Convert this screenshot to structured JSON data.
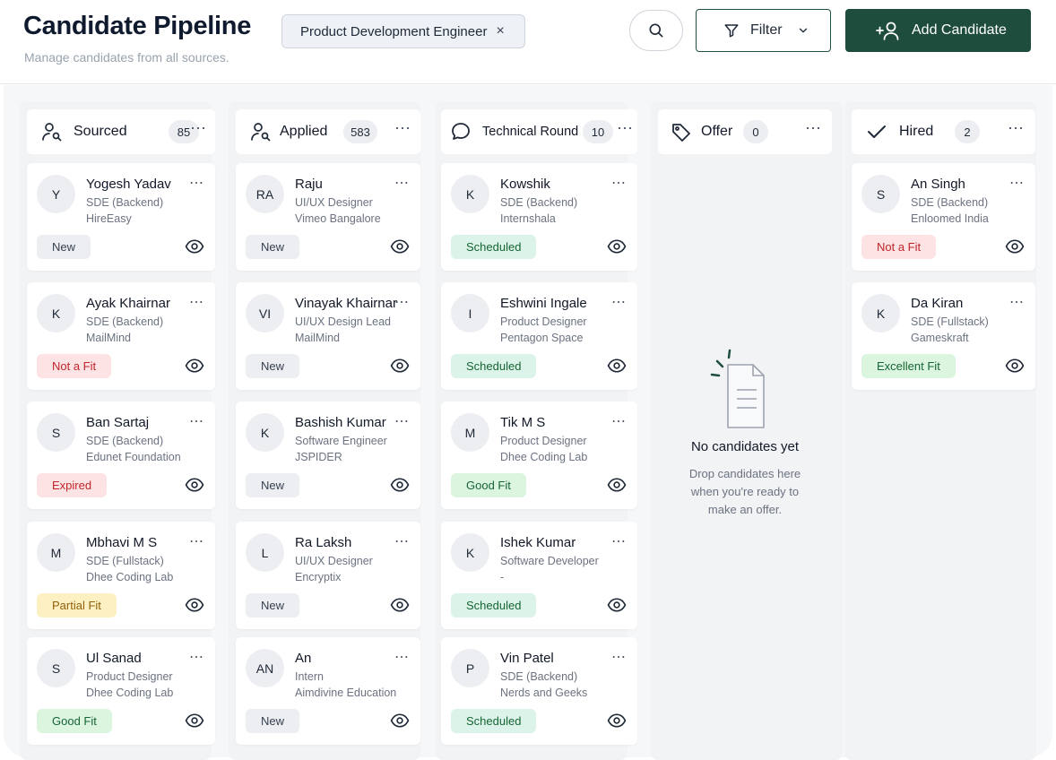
{
  "header": {
    "title": "Candidate Pipeline",
    "subtitle": "Manage candidates from all sources.",
    "job_chip": "Product Development Engineer",
    "job_chip_remove": "×",
    "filter_label": "Filter",
    "add_label": "Add Candidate"
  },
  "colors": {
    "accent": "#1e4d3e",
    "badge_new": "#eceef1",
    "badge_scheduled": "#dcf3e9",
    "badge_good": "#dcf5df",
    "badge_excellent": "#dcf5df",
    "badge_notfit": "#fde3e3",
    "badge_expired": "#fde3e3",
    "badge_partial": "#fdf1c4"
  },
  "columns": [
    {
      "title": "Sourced",
      "count": "85",
      "icon": "user-search-icon",
      "cards": [
        {
          "initials": "Y",
          "name": "Yogesh Yadav",
          "role": "SDE (Backend)",
          "org": "HireEasy",
          "status": "New",
          "kind": "new"
        },
        {
          "initials": "K",
          "name": "Ayak Khairnar",
          "role": "SDE (Backend)",
          "org": "MailMind",
          "status": "Not a Fit",
          "kind": "notfit"
        },
        {
          "initials": "S",
          "name": "Ban Sartaj",
          "role": "SDE (Backend)",
          "org": "Edunet Foundation",
          "status": "Expired",
          "kind": "expired"
        },
        {
          "initials": "M",
          "name": "Mbhavi M S",
          "role": "SDE (Fullstack)",
          "org": "Dhee Coding Lab",
          "status": "Partial Fit",
          "kind": "partial"
        },
        {
          "initials": "S",
          "name": "Ul Sanad",
          "role": "Product Designer",
          "org": "Dhee Coding Lab",
          "status": "Good Fit",
          "kind": "good"
        }
      ]
    },
    {
      "title": "Applied",
      "count": "583",
      "icon": "user-search-icon",
      "cards": [
        {
          "initials": "RA",
          "name": "Raju",
          "role": "UI/UX Designer",
          "org": "Vimeo Bangalore",
          "status": "New",
          "kind": "new"
        },
        {
          "initials": "VI",
          "name": "Vinayak Khairnar",
          "role": "UI/UX Design Lead",
          "org": "MailMind",
          "status": "New",
          "kind": "new"
        },
        {
          "initials": "K",
          "name": "Bashish Kumar",
          "role": "Software Engineer",
          "org": "JSPIDER",
          "status": "New",
          "kind": "new"
        },
        {
          "initials": "L",
          "name": "Ra Laksh",
          "role": "UI/UX Designer",
          "org": "Encryptix",
          "status": "New",
          "kind": "new"
        },
        {
          "initials": "AN",
          "name": "An",
          "role": "Intern",
          "org": "Aimdivine Education",
          "status": "New",
          "kind": "new"
        }
      ]
    },
    {
      "title": "Technical Round",
      "count": "10",
      "icon": "chat-bubble-icon",
      "cards": [
        {
          "initials": "K",
          "name": "Kowshik",
          "role": "SDE (Backend)",
          "org": "Internshala",
          "status": "Scheduled",
          "kind": "scheduled"
        },
        {
          "initials": "I",
          "name": "Eshwini Ingale",
          "role": "Product Designer",
          "org": "Pentagon Space",
          "status": "Scheduled",
          "kind": "scheduled"
        },
        {
          "initials": "M",
          "name": "Tik M S",
          "role": "Product Designer",
          "org": "Dhee Coding Lab",
          "status": "Good Fit",
          "kind": "good"
        },
        {
          "initials": "K",
          "name": "Ishek Kumar",
          "role": "Software Developer",
          "org": "-",
          "status": "Scheduled",
          "kind": "scheduled"
        },
        {
          "initials": "P",
          "name": "Vin Patel",
          "role": "SDE (Backend)",
          "org": "Nerds and Geeks",
          "status": "Scheduled",
          "kind": "scheduled"
        }
      ]
    },
    {
      "title": "Offer",
      "count": "0",
      "icon": "tag-icon",
      "cards": [],
      "empty_title": "No candidates yet",
      "empty_desc": "Drop candidates here when you're ready to make an offer."
    },
    {
      "title": "Hired",
      "count": "2",
      "icon": "check-icon",
      "cards": [
        {
          "initials": "S",
          "name": "An Singh",
          "role": "SDE (Backend)",
          "org": "Enloomed India",
          "status": "Not a Fit",
          "kind": "notfit"
        },
        {
          "initials": "K",
          "name": "Da Kiran",
          "role": "SDE (Fullstack)",
          "org": "Gameskraft",
          "status": "Excellent Fit",
          "kind": "excellent"
        }
      ]
    }
  ]
}
